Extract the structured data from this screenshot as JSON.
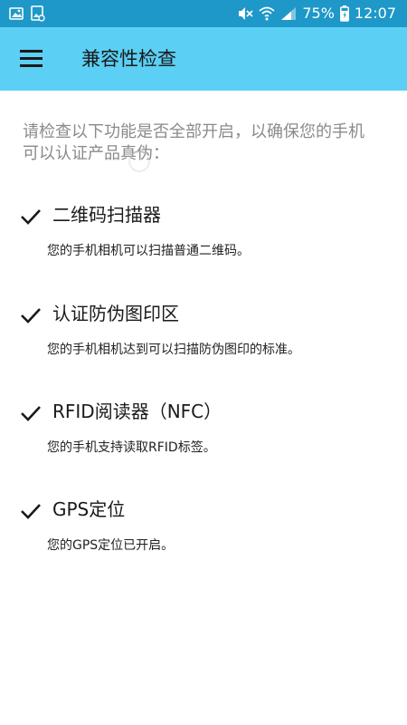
{
  "status_bar": {
    "left_icons": [
      "image-icon",
      "gallery-icon"
    ],
    "right_icons": [
      "mute-icon",
      "wifi-icon",
      "signal-icon",
      "battery-charging-icon"
    ],
    "battery": "75%",
    "time": "12:07"
  },
  "header": {
    "menu_icon": "hamburger-menu-icon",
    "title": "兼容性检查"
  },
  "main": {
    "intro": "请检查以下功能是否全部开启，以确保您的手机可以认证产品真伪：",
    "items": [
      {
        "title": "二维码扫描器",
        "description": "您的手机相机可以扫描普通二维码。",
        "icon": "check-icon"
      },
      {
        "title": "认证防伪图印区",
        "description": "您的手机相机达到可以扫描防伪图印的标准。",
        "icon": "check-icon"
      },
      {
        "title": "RFID阅读器（NFC）",
        "description": "您的手机支持读取RFID标签。",
        "icon": "check-icon"
      },
      {
        "title": "GPS定位",
        "description": "您的GPS定位已开启。",
        "icon": "check-icon"
      }
    ]
  },
  "colors": {
    "status_bar": "#1e98c8",
    "app_bar": "#5bcff4",
    "intro_text": "#8a8a8a",
    "title_text": "#1a1a1a"
  }
}
